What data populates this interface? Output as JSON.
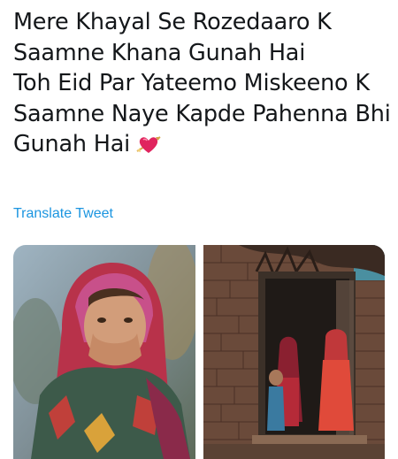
{
  "tweet": {
    "lines": [
      "Mere Khayal Se Rozedaaro K",
      "Saamne Khana Gunah Hai",
      "Toh Eid Par Yateemo Miskeeno K",
      "Saamne Naye Kapde Pahenna Bhi",
      "Gunah Hai"
    ],
    "emoji": "heart-with-arrow-icon",
    "translate_label": "Translate Tweet"
  },
  "media": {
    "photos": [
      {
        "icon": "girl-covering-mouth-photo"
      },
      {
        "icon": "children-in-doorway-photo"
      }
    ]
  },
  "colors": {
    "text": "#14171a",
    "link": "#1b95e0",
    "heart": "#e0245e"
  }
}
